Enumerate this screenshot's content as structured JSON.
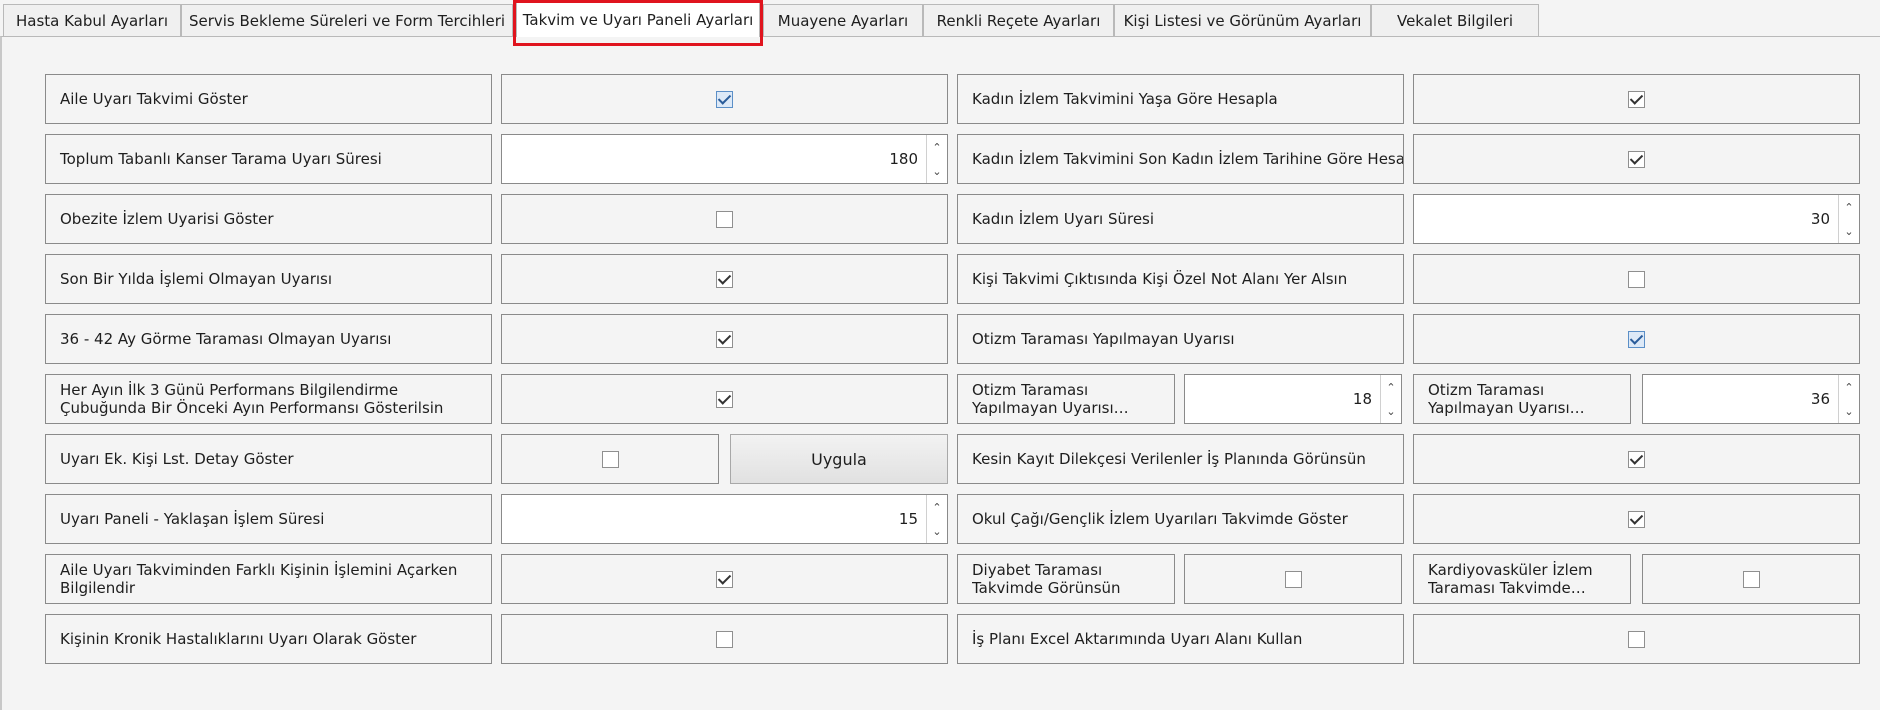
{
  "tabs": [
    {
      "label": "Hasta Kabul Ayarları"
    },
    {
      "label": "Servis Bekleme Süreleri ve Form Tercihleri"
    },
    {
      "label": "Takvim ve Uyarı Paneli Ayarları"
    },
    {
      "label": "Muayene Ayarları"
    },
    {
      "label": "Renkli Reçete Ayarları"
    },
    {
      "label": "Kişi Listesi ve Görünüm Ayarları"
    },
    {
      "label": "Vekalet Bilgileri"
    }
  ],
  "active_tab": "Takvim ve Uyarı Paneli Ayarları",
  "left": {
    "aile_uyari_takvimi": {
      "label": "Aile Uyarı Takvimi Göster",
      "checked": true
    },
    "kanser_tarama": {
      "label": "Toplum Tabanlı Kanser Tarama Uyarı Süresi",
      "value": "180"
    },
    "obezite": {
      "label": "Obezite İzlem Uyarisi Göster",
      "checked": false
    },
    "son_bir_yil": {
      "label": "Son Bir Yılda İşlemi Olmayan Uyarısı",
      "checked": true
    },
    "gorme_tarama": {
      "label": "36 - 42 Ay Görme Taraması Olmayan Uyarısı",
      "checked": true
    },
    "performans": {
      "label": "Her Ayın İlk 3 Günü Performans Bilgilendirme Çubuğunda Bir Önceki Ayın Performansı Gösterilsin",
      "checked": true
    },
    "uyari_ek": {
      "label": "Uyarı Ek. Kişi Lst. Detay Göster",
      "checked": false,
      "button": "Uygula"
    },
    "yaklasan_islem": {
      "label": "Uyarı Paneli - Yaklaşan İşlem Süresi",
      "value": "15"
    },
    "farkli_kisi": {
      "label": "Aile Uyarı Takviminden Farklı Kişinin İşlemini Açarken Bilgilendir",
      "checked": true
    },
    "kronik": {
      "label": "Kişinin Kronik Hastalıklarını Uyarı Olarak Göster",
      "checked": false
    }
  },
  "right": {
    "kadin_yas": {
      "label": "Kadın İzlem Takvimini Yaşa Göre Hesapla",
      "checked": true
    },
    "kadin_son_tarih": {
      "label": "Kadın İzlem Takvimini Son Kadın İzlem Tarihine Göre Hesapla",
      "checked": true
    },
    "kadin_uyari_suresi": {
      "label": "Kadın İzlem Uyarı Süresi",
      "value": "30"
    },
    "ozel_not": {
      "label": "Kişi Takvimi Çıktısında Kişi Özel Not Alanı Yer Alsın",
      "checked": false
    },
    "otizm": {
      "label": "Otizm Taraması Yapılmayan Uyarısı",
      "checked": true
    },
    "otizm_baslangic": {
      "label": "Otizm Taraması Yapılmayan Uyarısı Görünecek Başlangıç",
      "value": "18"
    },
    "otizm_bitis": {
      "label": "Otizm Taraması Yapılmayan Uyarısı Görünecek Bitiş",
      "value": "36"
    },
    "kesin_kayit": {
      "label": "Kesin Kayıt Dilekçesi Verilenler İş Planında Görünsün",
      "checked": true
    },
    "okul_cagi": {
      "label": "Okul Çağı/Gençlik İzlem Uyarıları Takvimde Göster",
      "checked": true
    },
    "diyabet": {
      "label": "Diyabet Taraması Takvimde Görünsün",
      "checked": false
    },
    "kardiyo": {
      "label": "Kardiyovasküler İzlem Taraması Takvimde Görünsün",
      "checked": false
    },
    "excel": {
      "label": "İş Planı Excel Aktarımında Uyarı Alanı Kullan",
      "checked": false
    }
  }
}
